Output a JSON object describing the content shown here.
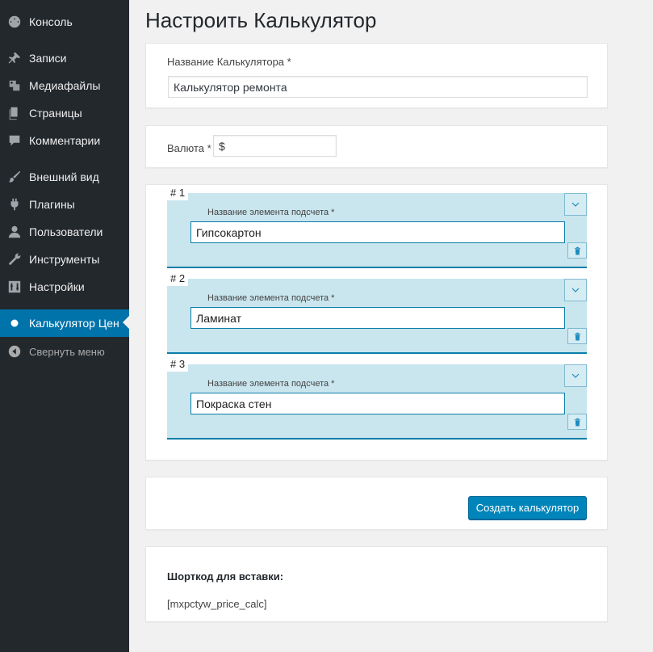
{
  "sidebar": {
    "items": [
      {
        "label": "Консоль",
        "icon": "dashboard-icon"
      },
      {
        "label": "Записи",
        "icon": "pin-icon"
      },
      {
        "label": "Медиафайлы",
        "icon": "media-icon"
      },
      {
        "label": "Страницы",
        "icon": "pages-icon"
      },
      {
        "label": "Комментарии",
        "icon": "comment-icon"
      },
      {
        "label": "Внешний вид",
        "icon": "brush-icon"
      },
      {
        "label": "Плагины",
        "icon": "plugin-icon"
      },
      {
        "label": "Пользователи",
        "icon": "user-icon"
      },
      {
        "label": "Инструменты",
        "icon": "wrench-icon"
      },
      {
        "label": "Настройки",
        "icon": "settings-icon"
      },
      {
        "label": "Калькулятор Цен",
        "icon": "calculator-plugin-icon",
        "active": true
      },
      {
        "label": "Свернуть меню",
        "icon": "collapse-icon"
      }
    ]
  },
  "page": {
    "title": "Настроить Калькулятор"
  },
  "name_panel": {
    "label": "Название Калькулятора *",
    "value": "Калькулятор ремонта"
  },
  "currency_panel": {
    "label": "Валюта *",
    "value": "$"
  },
  "elements": [
    {
      "number": "# 1",
      "label": "Название элемента подсчета *",
      "value": "Гипсокартон"
    },
    {
      "number": "# 2",
      "label": "Название элемента подсчета *",
      "value": "Ламинат"
    },
    {
      "number": "# 3",
      "label": "Название элемента подсчета *",
      "value": "Покраска стен"
    }
  ],
  "actions": {
    "create_label": "Создать калькулятор"
  },
  "shortcode": {
    "heading": "Шорткод для вставки:",
    "code": "[mxpctyw_price_calc]"
  },
  "colors": {
    "sidebar_bg": "#23282d",
    "accent": "#0073aa",
    "button": "#0085ba",
    "row_bg": "#c9e5ee"
  }
}
